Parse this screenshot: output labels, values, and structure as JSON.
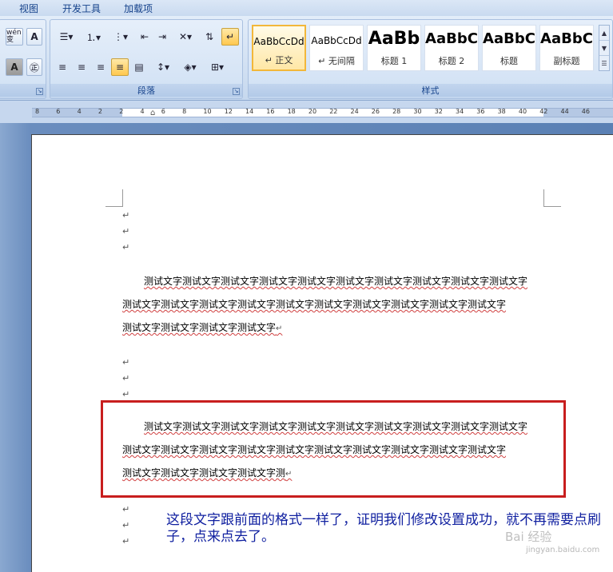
{
  "menubar": {
    "items": [
      "视图",
      "开发工具",
      "加载项"
    ]
  },
  "ribbon": {
    "font_group": {
      "buttons": [
        "wén 变",
        "A",
        "A",
        "㊣"
      ]
    },
    "paragraph_group": {
      "label": "段落",
      "launcher": "↘"
    },
    "styles_group": {
      "label": "样式",
      "styles": [
        {
          "preview": "AaBbCcDd",
          "name": "↵ 正文",
          "selected": true
        },
        {
          "preview": "AaBbCcDd",
          "name": "↵ 无间隔",
          "selected": false
        },
        {
          "preview": "AaBb",
          "name": "标题 1",
          "selected": false
        },
        {
          "preview": "AaBbC",
          "name": "标题 2",
          "selected": false
        },
        {
          "preview": "AaBbC",
          "name": "标题",
          "selected": false
        },
        {
          "preview": "AaBbC",
          "name": "副标题",
          "selected": false
        }
      ]
    }
  },
  "ruler": {
    "ticks": [
      "8",
      "6",
      "4",
      "2",
      "2",
      "4",
      "6",
      "8",
      "10",
      "12",
      "14",
      "16",
      "18",
      "20",
      "22",
      "24",
      "26",
      "28",
      "30",
      "32",
      "34",
      "36",
      "38",
      "40",
      "42",
      "44",
      "46"
    ]
  },
  "document": {
    "paragraph_mark": "↵",
    "paragraph1": {
      "lines": [
        "测试文字测试文字测试文字测试文字测试文字测试文字测试文字测试文字测试文字测试文字",
        "测试文字测试文字测试文字测试文字测试文字测试文字测试文字测试文字测试文字测试文字",
        "测试文字测试文字测试文字测试文字"
      ]
    },
    "paragraph2": {
      "lines": [
        "测试文字测试文字测试文字测试文字测试文字测试文字测试文字测试文字测试文字测试文字",
        "测试文字测试文字测试文字测试文字测试文字测试文字测试文字测试文字测试文字测试文字",
        "测试文字测试文字测试文字测试文字测"
      ]
    },
    "note": "这段文字跟前面的格式一样了，证明我们修改设置成功，就不再需要点刷子，点来点去了。",
    "watermark": "Bai 经验",
    "watermark_sub": "jingyan.baidu.com"
  },
  "colors": {
    "highlight_box": "#c81e1e",
    "note_text": "#1020a0",
    "selected_style": "#f2b73a"
  }
}
